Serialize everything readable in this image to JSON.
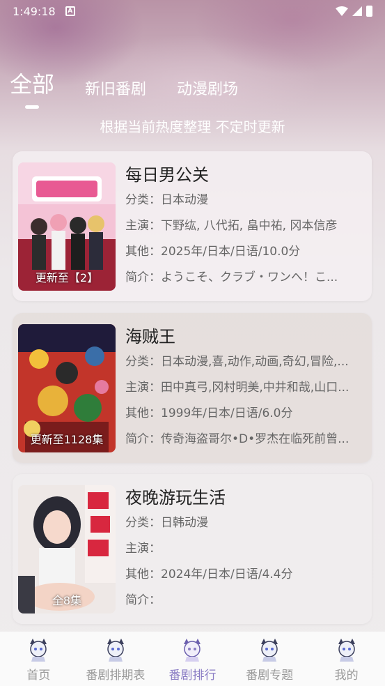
{
  "status": {
    "time": "1:49:18",
    "notif": "A"
  },
  "tabs": [
    {
      "label": "全部"
    },
    {
      "label": "新旧番剧"
    },
    {
      "label": "动漫剧场"
    }
  ],
  "subtitle": "根据当前热度整理 不定时更新",
  "labels": {
    "category": "分类：",
    "cast": "主演：",
    "other": "其他：",
    "intro": "简介："
  },
  "items": [
    {
      "title": "每日男公关",
      "badge": "更新至【2】",
      "category": "日本动漫",
      "cast": "下野纮, 八代拓, 畠中祐, 冈本信彦",
      "other": "2025年/日本/日语/10.0分",
      "intro": "ようこそ、クラブ・ワンへ！こ..."
    },
    {
      "title": "海贼王",
      "badge": "更新至1128集",
      "category": "日本动漫,喜,动作,动画,奇幻,冒险,...",
      "cast": "田中真弓,冈村明美,中井和哉,山口...",
      "other": "1999年/日本/日语/6.0分",
      "intro": "传奇海盗哥尔•D•罗杰在临死前曾..."
    },
    {
      "title": "夜晚游玩生活",
      "badge": "全8集",
      "category": "日韩动漫",
      "cast": "",
      "other": "2024年/日本/日语/4.4分",
      "intro": ""
    }
  ],
  "nav": [
    {
      "label": "首页",
      "icon": "cat-girl-icon"
    },
    {
      "label": "番剧排期表",
      "icon": "cat-girl-icon"
    },
    {
      "label": "番剧排行",
      "icon": "cat-girl-icon"
    },
    {
      "label": "番剧专题",
      "icon": "cat-girl-icon"
    },
    {
      "label": "我的",
      "icon": "cat-girl-icon"
    }
  ],
  "colors": {
    "accent": "#8a7cc4",
    "inactive": "#9a9a9a"
  }
}
